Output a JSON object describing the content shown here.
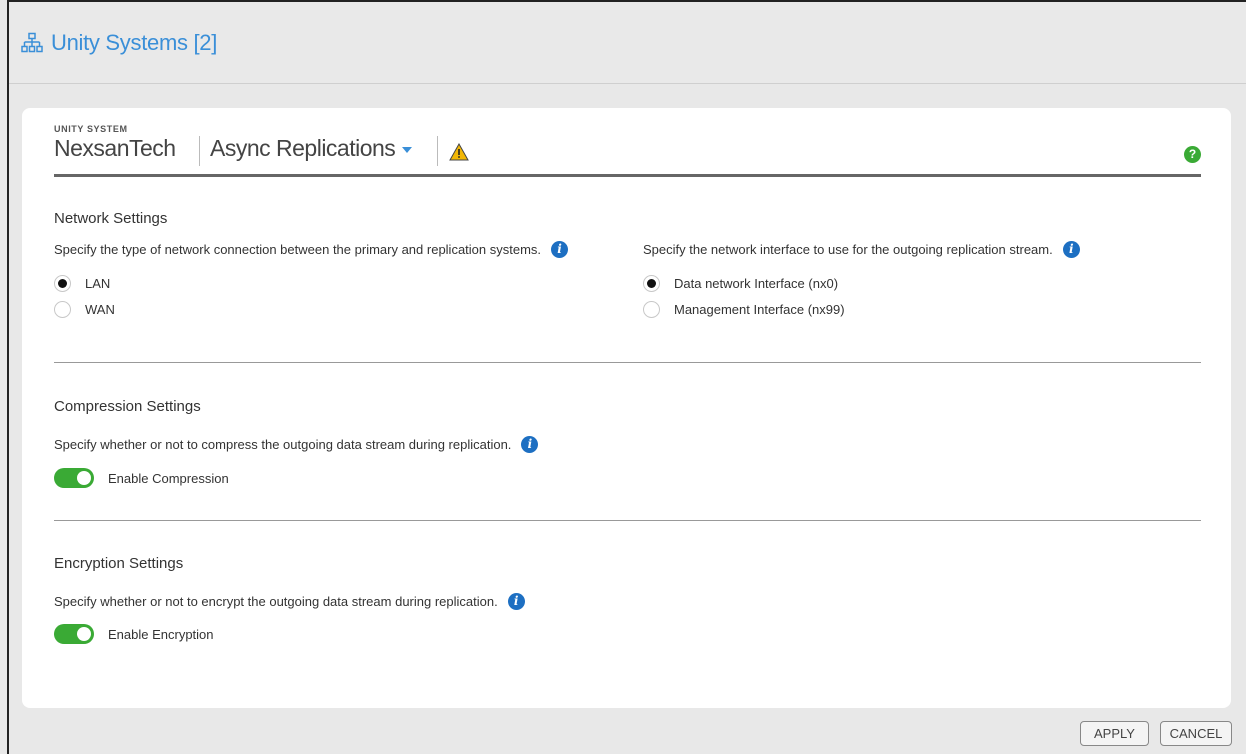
{
  "window": {
    "title": "Unity Systems [2]",
    "icon": "network-tree-icon"
  },
  "header": {
    "system_label": "UNITY SYSTEM",
    "system_name": "NexsanTech",
    "page_selector": "Async Replications",
    "warning_icon": "warning-icon",
    "help_icon": "help-icon",
    "help_glyph": "?"
  },
  "network": {
    "title": "Network Settings",
    "connection_desc": "Specify the type of network connection between the primary and replication systems.",
    "connection_options": [
      {
        "label": "LAN",
        "selected": true
      },
      {
        "label": "WAN",
        "selected": false
      }
    ],
    "interface_desc": "Specify the network interface to use for the outgoing replication stream.",
    "interface_options": [
      {
        "label": "Data network Interface (nx0)",
        "selected": true
      },
      {
        "label": "Management Interface (nx99)",
        "selected": false
      }
    ]
  },
  "compression": {
    "title": "Compression Settings",
    "desc": "Specify whether or not to compress the outgoing data stream during replication.",
    "toggle_label": "Enable Compression",
    "enabled": true
  },
  "encryption": {
    "title": "Encryption Settings",
    "desc": "Specify whether or not to encrypt the outgoing data stream during replication.",
    "toggle_label": "Enable Encryption",
    "enabled": true
  },
  "info_glyph": "i",
  "footer": {
    "apply_label": "APPLY",
    "cancel_label": "CANCEL"
  },
  "colors": {
    "accent_blue": "#3a8fd8",
    "info_blue": "#1d6fc2",
    "toggle_green": "#3aaa35",
    "warning_yellow": "#f2b705"
  }
}
